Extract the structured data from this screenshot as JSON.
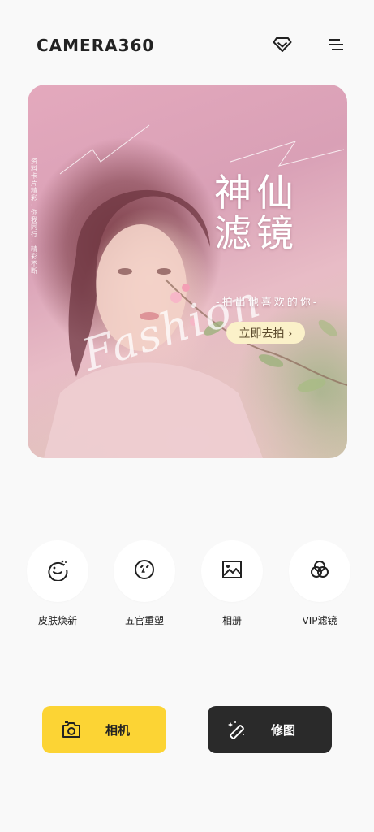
{
  "header": {
    "logo": "CAMERA360",
    "vip_icon": "diamond-icon",
    "menu_icon": "menu-icon"
  },
  "banner": {
    "title": "神仙滤镜",
    "subtitle": "-拍出他喜欢的你-",
    "cta": "立即去拍 ›",
    "script_text": "Fashion",
    "side_text": "资料卡片精彩·你我同行·精彩不断"
  },
  "features": [
    {
      "label": "皮肤焕新",
      "icon": "face-beauty-icon"
    },
    {
      "label": "五官重塑",
      "icon": "face-reshape-icon"
    },
    {
      "label": "相册",
      "icon": "album-icon"
    },
    {
      "label": "VIP滤镜",
      "icon": "filter-icon"
    }
  ],
  "actions": {
    "camera": {
      "label": "相机",
      "icon": "camera-icon",
      "color": "#fcd434"
    },
    "retouch": {
      "label": "修图",
      "icon": "magic-wand-icon",
      "color": "#2a2a2a"
    }
  }
}
